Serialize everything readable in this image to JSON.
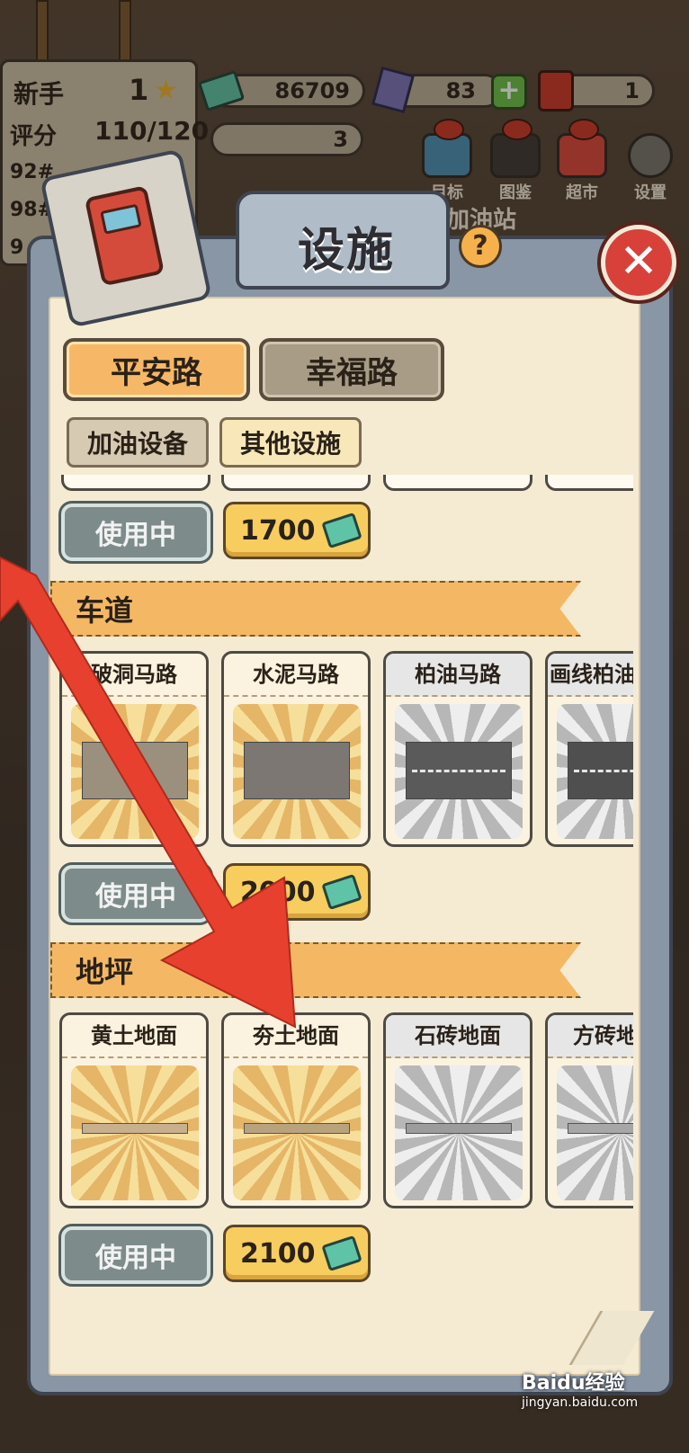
{
  "hud": {
    "rank_label": "新手",
    "rank_level": "1",
    "score_label": "评分",
    "score_value": "110/120",
    "side_items": [
      "92#",
      "98#",
      "9"
    ],
    "cash": "86709",
    "gems": "83",
    "crown": "1",
    "hearts": "3"
  },
  "nav": {
    "items": [
      {
        "label": "目标"
      },
      {
        "label": "图鉴"
      },
      {
        "label": "超市"
      },
      {
        "label": "设置"
      }
    ],
    "station_label": "加油站"
  },
  "dialog": {
    "title": "设施",
    "help_label": "?",
    "close_label": "✕",
    "road_tabs": [
      "平安路",
      "幸福路"
    ],
    "sub_tabs": [
      "加油设备",
      "其他设施"
    ],
    "top_row": {
      "status": "使用中",
      "price": "1700"
    },
    "sections": [
      {
        "title": "车道",
        "items": [
          "破洞马路",
          "水泥马路",
          "柏油马路",
          "画线柏油"
        ],
        "status": "使用中",
        "price": "2000"
      },
      {
        "title": "地坪",
        "items": [
          "黄土地面",
          "夯土地面",
          "石砖地面",
          "方砖地"
        ],
        "status": "使用中",
        "price": "2100"
      }
    ]
  },
  "watermark": {
    "brand": "Baidu经验",
    "url": "jingyan.baidu.com"
  },
  "colors": {
    "accent": "#f6b866",
    "arrow": "#e8402f",
    "close": "#d8403a"
  }
}
